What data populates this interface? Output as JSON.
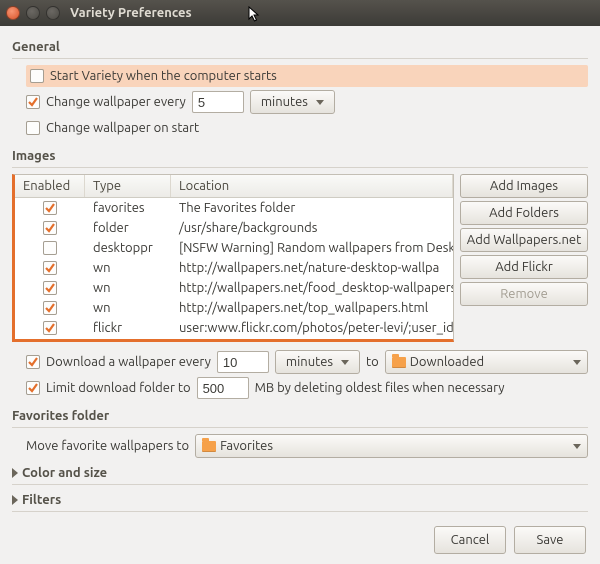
{
  "window": {
    "title": "Variety Preferences"
  },
  "general": {
    "label": "General",
    "start_with_computer": {
      "checked": false,
      "label": "Start Variety when the computer starts",
      "highlight": true
    },
    "change_every": {
      "checked": true,
      "label": "Change wallpaper every",
      "value": "5",
      "unit": "minutes"
    },
    "change_on_start": {
      "checked": false,
      "label": "Change wallpaper on start"
    }
  },
  "images": {
    "label": "Images",
    "columns": {
      "enabled": "Enabled",
      "type": "Type",
      "location": "Location"
    },
    "rows": [
      {
        "enabled": true,
        "type": "favorites",
        "location": "The Favorites folder"
      },
      {
        "enabled": true,
        "type": "folder",
        "location": "/usr/share/backgrounds"
      },
      {
        "enabled": false,
        "type": "desktoppr",
        "location": "[NSFW Warning] Random wallpapers from Desk"
      },
      {
        "enabled": true,
        "type": "wn",
        "location": "http://wallpapers.net/nature-desktop-wallpa"
      },
      {
        "enabled": true,
        "type": "wn",
        "location": "http://wallpapers.net/food_desktop-wallpapers"
      },
      {
        "enabled": true,
        "type": "wn",
        "location": "http://wallpapers.net/top_wallpapers.html"
      },
      {
        "enabled": true,
        "type": "flickr",
        "location": "user:www.flickr.com/photos/peter-levi/;user_id"
      }
    ],
    "buttons": {
      "add_images": "Add Images",
      "add_folders": "Add Folders",
      "add_wallpapers_net": "Add Wallpapers.net",
      "add_flickr": "Add Flickr",
      "remove": "Remove"
    },
    "download_every": {
      "checked": true,
      "label": "Download a wallpaper every",
      "value": "10",
      "unit": "minutes",
      "to": "to",
      "dest": "Downloaded"
    },
    "limit_folder": {
      "checked": true,
      "label": "Limit download folder to",
      "value": "500",
      "suffix": "MB by deleting oldest files when necessary"
    }
  },
  "favorites": {
    "label": "Favorites folder",
    "move_label": "Move favorite wallpapers to",
    "dest": "Favorites"
  },
  "expanders": {
    "color_size": "Color and size",
    "filters": "Filters"
  },
  "footer": {
    "cancel": "Cancel",
    "save": "Save"
  }
}
